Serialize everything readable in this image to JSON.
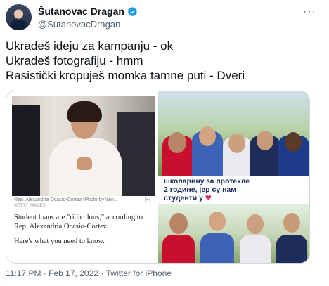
{
  "header": {
    "name": "Šutanovac Dragan",
    "handle": "@SutanovacDragan",
    "more_label": "···"
  },
  "tweet": {
    "lines": [
      "Ukradeš ideju za kampanju - ok",
      "Ukradeš fotografiju - hmm",
      "Rasistički kropuješ momka tamne puti - Dveri"
    ]
  },
  "media": {
    "left_card": {
      "caption": "Rep. Alexandria Ocasio-Cortez (Photo by Win...",
      "credit": "GETTY IMAGES",
      "bracket": "[+]",
      "paragraph_1": "Student loans are \"ridiculous,\" according to Rep. Alexandria Ocasio-Cortez.",
      "paragraph_2": "Here's what you need to know."
    },
    "right_card": {
      "text_line_1": "школарину за протекле",
      "text_line_2": "2 године, јер су нам",
      "text_line_3": "студенти у"
    }
  },
  "meta": {
    "time": "11:17 PM",
    "sep": " · ",
    "date": "Feb 17, 2022",
    "sep2": " · ",
    "source": "Twitter for iPhone"
  },
  "colors": {
    "verified": "#1d9bf0",
    "secondary_text": "#536471",
    "border": "#cfd9de"
  }
}
